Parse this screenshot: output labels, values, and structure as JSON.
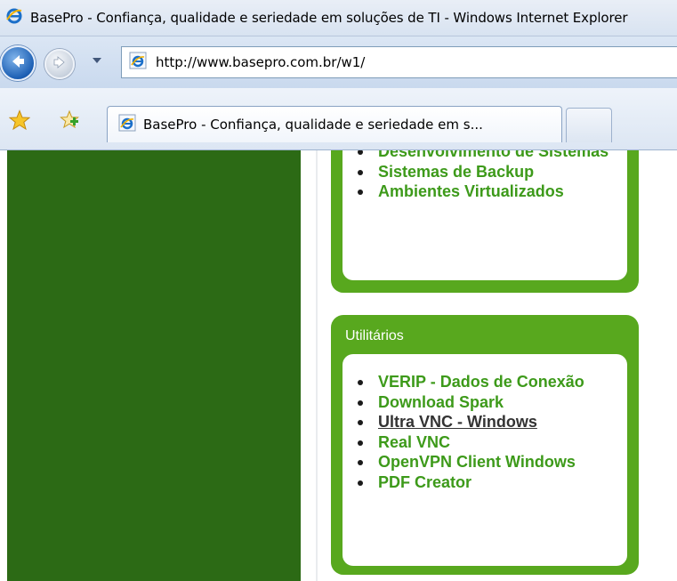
{
  "window": {
    "title": "BasePro - Confiança, qualidade e seriedade em soluções de TI - Windows Internet Explorer"
  },
  "address_bar": {
    "url": "http://www.basepro.com.br/w1/"
  },
  "tabs": [
    {
      "label": "BasePro - Confiança, qualidade e seriedade em s..."
    }
  ],
  "icons": {
    "back": "back-arrow-icon",
    "forward": "forward-arrow-icon",
    "favorites": "favorites-star-icon",
    "add_favorites": "add-favorites-icon",
    "ie": "internet-explorer-icon"
  },
  "colors": {
    "sidebar_green": "#2c6a15",
    "box_green": "#58a81e",
    "link_green": "#3d9a1a"
  },
  "services_box": {
    "items": [
      "Desenvolvimento de Sistemas",
      "Sistemas de Backup",
      "Ambientes Virtualizados"
    ]
  },
  "utilities_box": {
    "title": "Utilitários",
    "items": [
      "VERIP - Dados de Conexão",
      "Download Spark",
      "Ultra VNC - Windows",
      "Real VNC",
      "OpenVPN Client Windows",
      "PDF Creator"
    ]
  }
}
